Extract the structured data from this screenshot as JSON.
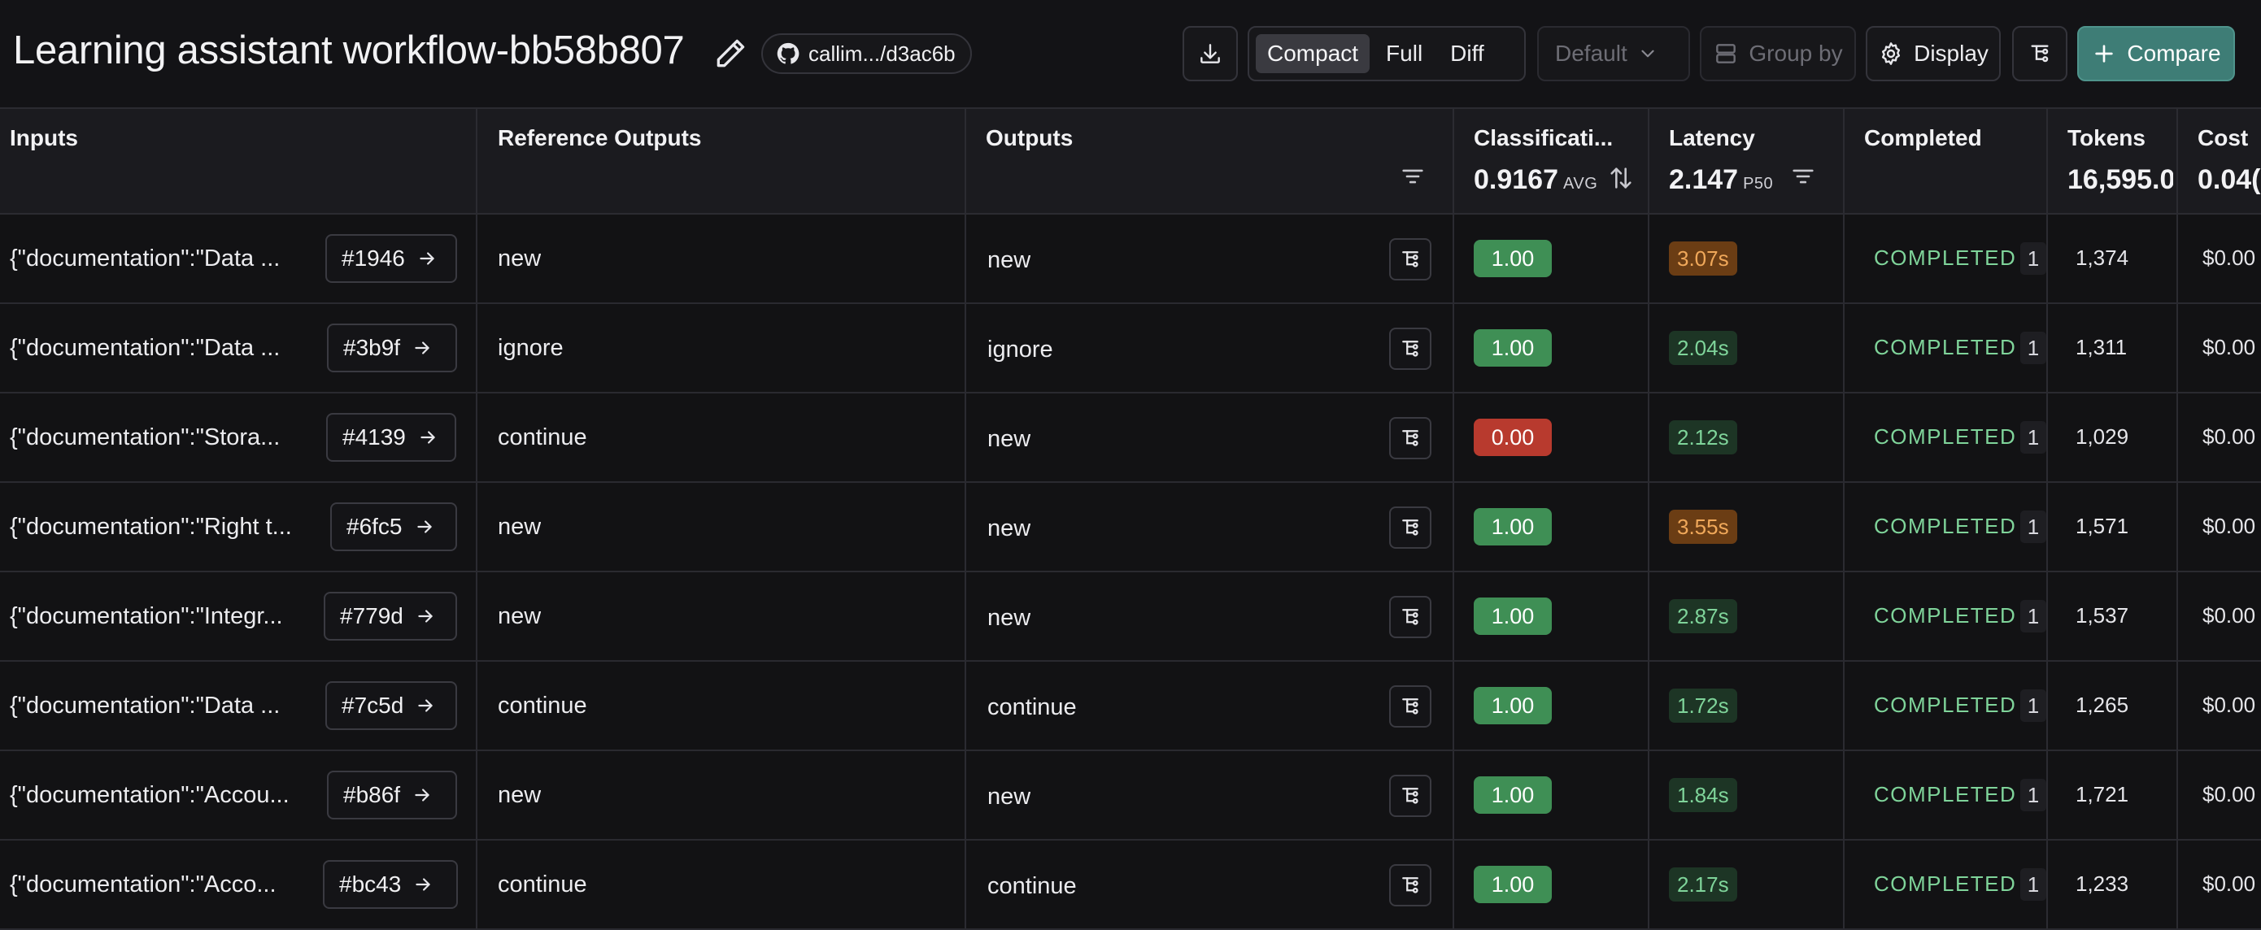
{
  "header": {
    "title": "Learning assistant workflow-bb58b807",
    "repo_label": "callim.../d3ac6b",
    "view_modes": [
      "Compact",
      "Full",
      "Diff"
    ],
    "active_view_mode": "Compact",
    "default_select": "Default",
    "group_by_label": "Group by",
    "display_label": "Display",
    "compare_label": "Compare",
    "accent_color": "#3e7d76"
  },
  "table": {
    "columns": {
      "inputs": "Inputs",
      "reference_outputs": "Reference Outputs",
      "outputs": "Outputs",
      "classification": "Classificati...",
      "latency": "Latency",
      "completed": "Completed",
      "tokens": "Tokens",
      "cost": "Cost"
    },
    "stats": {
      "classification_value": "0.9167",
      "classification_unit": "AVG",
      "latency_value": "2.147",
      "latency_unit": "P50",
      "tokens_value": "16,595.0",
      "cost_value": "0.04("
    },
    "rows": [
      {
        "input": "{\"documentation\":\"Data ...",
        "ref": "#1946",
        "reference": "new",
        "output": "new",
        "score": "1.00",
        "latency": "3.07s",
        "latency_level": "slow",
        "status": "COMPLETED",
        "count": "1",
        "tokens": "1,374",
        "cost": "$0.00"
      },
      {
        "input": "{\"documentation\":\"Data ...",
        "ref": "#3b9f",
        "reference": "ignore",
        "output": "ignore",
        "score": "1.00",
        "latency": "2.04s",
        "latency_level": "fast",
        "status": "COMPLETED",
        "count": "1",
        "tokens": "1,311",
        "cost": "$0.00"
      },
      {
        "input": "{\"documentation\":\"Stora...",
        "ref": "#4139",
        "reference": "continue",
        "output": "new",
        "score": "0.00",
        "latency": "2.12s",
        "latency_level": "fast",
        "status": "COMPLETED",
        "count": "1",
        "tokens": "1,029",
        "cost": "$0.00"
      },
      {
        "input": "{\"documentation\":\"Right t...",
        "ref": "#6fc5",
        "reference": "new",
        "output": "new",
        "score": "1.00",
        "latency": "3.55s",
        "latency_level": "slow",
        "status": "COMPLETED",
        "count": "1",
        "tokens": "1,571",
        "cost": "$0.00"
      },
      {
        "input": "{\"documentation\":\"Integr...",
        "ref": "#779d",
        "reference": "new",
        "output": "new",
        "score": "1.00",
        "latency": "2.87s",
        "latency_level": "fast",
        "status": "COMPLETED",
        "count": "1",
        "tokens": "1,537",
        "cost": "$0.00"
      },
      {
        "input": "{\"documentation\":\"Data ...",
        "ref": "#7c5d",
        "reference": "continue",
        "output": "continue",
        "score": "1.00",
        "latency": "1.72s",
        "latency_level": "fast",
        "status": "COMPLETED",
        "count": "1",
        "tokens": "1,265",
        "cost": "$0.00"
      },
      {
        "input": "{\"documentation\":\"Accou...",
        "ref": "#b86f",
        "reference": "new",
        "output": "new",
        "score": "1.00",
        "latency": "1.84s",
        "latency_level": "fast",
        "status": "COMPLETED",
        "count": "1",
        "tokens": "1,721",
        "cost": "$0.00"
      },
      {
        "input": "{\"documentation\":\"Acco...",
        "ref": "#bc43",
        "reference": "continue",
        "output": "continue",
        "score": "1.00",
        "latency": "2.17s",
        "latency_level": "fast",
        "status": "COMPLETED",
        "count": "1",
        "tokens": "1,233",
        "cost": "$0.00"
      }
    ]
  },
  "colors": {
    "score_pass": "#3f8f55",
    "score_fail": "#b83a2e",
    "latency_slow_bg": "#6b3d14",
    "latency_slow_fg": "#f0a85a",
    "latency_fast_bg": "#1d3525",
    "latency_fast_fg": "#7fd49a",
    "status": "#7fd49a"
  }
}
